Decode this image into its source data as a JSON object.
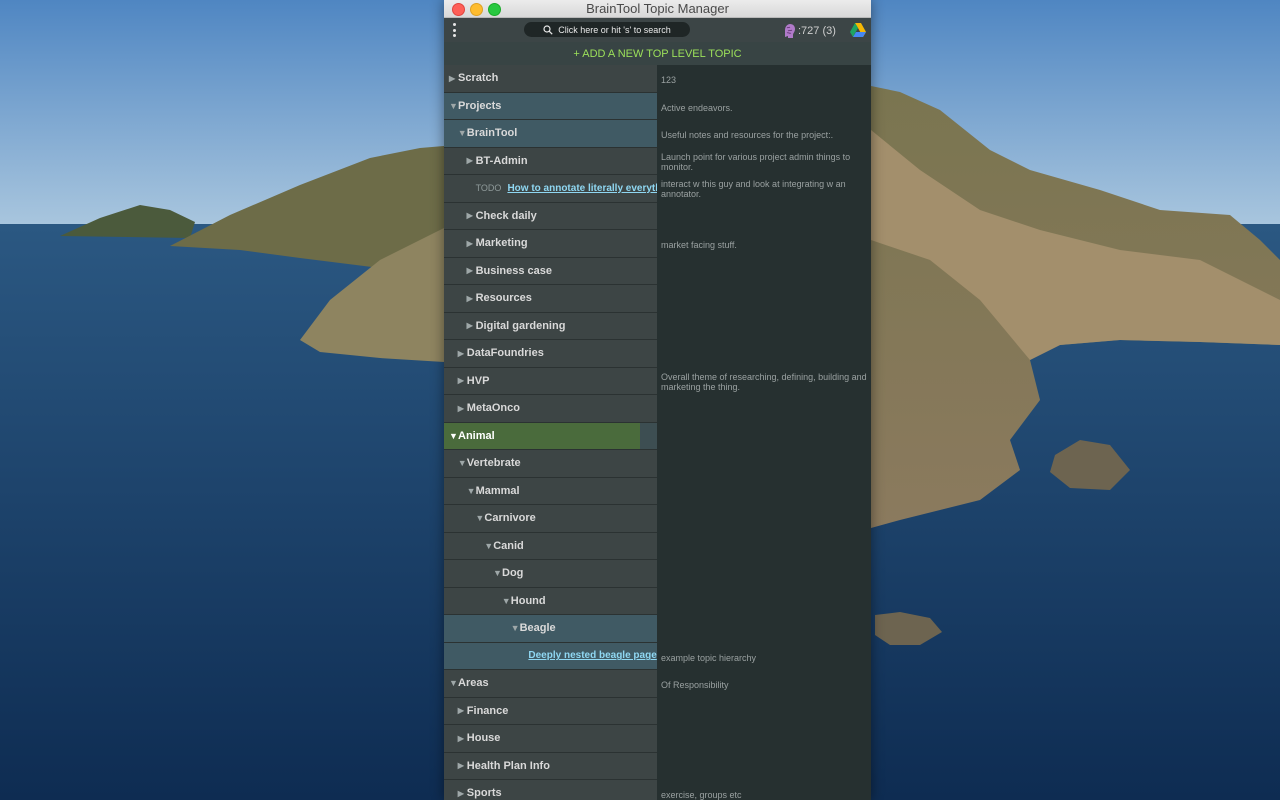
{
  "window": {
    "title": "BrainTool Topic Manager"
  },
  "header": {
    "search_placeholder": "Click here or hit 's' to search",
    "stats": ":727 (3)"
  },
  "add_topic_label": "+ ADD A NEW TOP LEVEL TOPIC",
  "rows": [
    {
      "label": "Scratch",
      "level": 0,
      "state": "closed",
      "note": "123"
    },
    {
      "label": "Projects",
      "level": 0,
      "state": "open",
      "note": "Active endeavors.",
      "selected": true
    },
    {
      "label": "BrainTool",
      "level": 1,
      "state": "open",
      "note": "Useful notes and resources for the project:.",
      "selected": true
    },
    {
      "label": "BT-Admin",
      "level": 2,
      "state": "closed",
      "note": "Launch point for various project admin things to monitor."
    },
    {
      "todo": "TODO",
      "link": "How to annotate literally everything...",
      "level": 2,
      "note": "interact w this guy and look at integrating w an annotator."
    },
    {
      "label": "Check daily",
      "level": 2,
      "state": "closed",
      "note": ""
    },
    {
      "label": "Marketing",
      "level": 2,
      "state": "closed",
      "note": "market facing stuff."
    },
    {
      "label": "Business case",
      "level": 2,
      "state": "closed",
      "note": ""
    },
    {
      "label": "Resources",
      "level": 2,
      "state": "closed",
      "note": ""
    },
    {
      "label": "Digital gardening",
      "level": 2,
      "state": "closed",
      "note": ""
    },
    {
      "label": "DataFoundries",
      "level": 1,
      "state": "closed",
      "note": ""
    },
    {
      "label": "HVP",
      "level": 1,
      "state": "closed",
      "note": "Overall theme of researching, defining, building and marketing the thing."
    },
    {
      "label": "MetaOnco",
      "level": 1,
      "state": "closed",
      "note": ""
    },
    {
      "label": "Animal",
      "level": 0,
      "state": "open",
      "note": "",
      "highlight": true
    },
    {
      "label": "Vertebrate",
      "level": 1,
      "state": "open",
      "note": ""
    },
    {
      "label": "Mammal",
      "level": 2,
      "state": "open",
      "note": ""
    },
    {
      "label": "Carnivore",
      "level": 3,
      "state": "open",
      "note": ""
    },
    {
      "label": "Canid",
      "level": 4,
      "state": "open",
      "note": ""
    },
    {
      "label": "Dog",
      "level": 5,
      "state": "open",
      "note": ""
    },
    {
      "label": "Hound",
      "level": 6,
      "state": "open",
      "note": ""
    },
    {
      "label": "Beagle",
      "level": 7,
      "state": "open",
      "note": "",
      "selected": true
    },
    {
      "link": "Deeply nested beagle page",
      "level": 8,
      "note": "example topic hierarchy",
      "selected": true
    },
    {
      "label": "Areas",
      "level": 0,
      "state": "open",
      "note": "Of Responsibility"
    },
    {
      "label": "Finance",
      "level": 1,
      "state": "closed",
      "note": ""
    },
    {
      "label": "House",
      "level": 1,
      "state": "closed",
      "note": ""
    },
    {
      "label": "Health Plan Info",
      "level": 1,
      "state": "closed",
      "note": ""
    },
    {
      "label": "Sports",
      "level": 1,
      "state": "closed",
      "note": "exercise, groups etc"
    }
  ],
  "icons": {
    "menu": "vertical-dots-icon",
    "search": "magnifier-icon",
    "brain": "brain-icon",
    "drive": "google-drive-icon"
  },
  "colors": {
    "accent_green_text": "#9ce05a",
    "highlight_row": "#4a6b3c",
    "selected_row": "#405a64",
    "link": "#8fd7f2"
  }
}
